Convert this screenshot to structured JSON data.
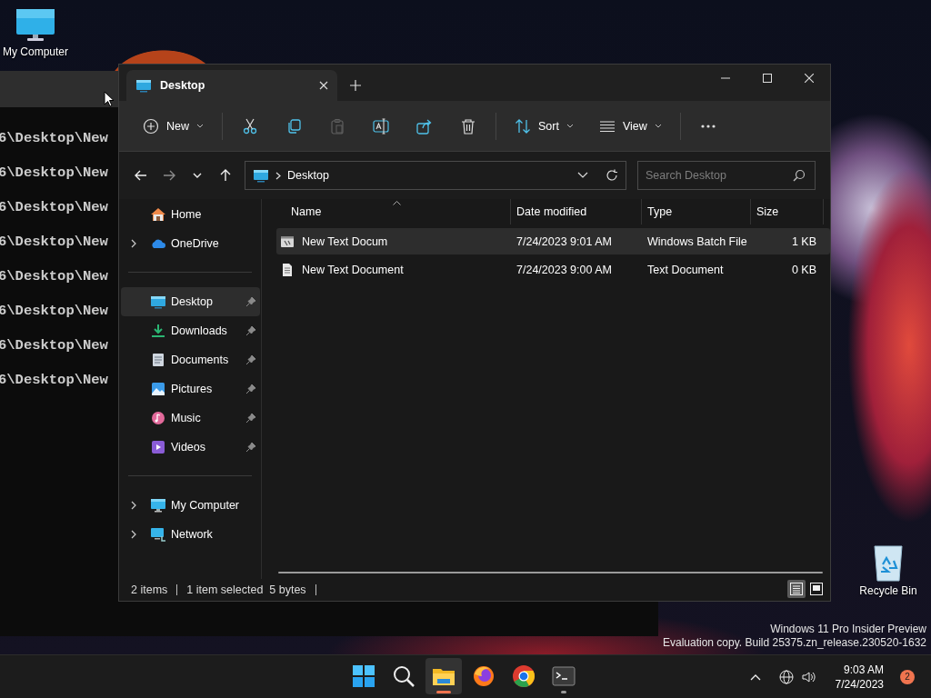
{
  "desktop_icons": [
    {
      "kind": "computer",
      "label": "My Computer"
    },
    {
      "kind": "recycle",
      "label": "Recycle Bin"
    }
  ],
  "terminal": {
    "lines": [
      "6\\Desktop\\New",
      "6\\Desktop\\New",
      "6\\Desktop\\New",
      "6\\Desktop\\New",
      "6\\Desktop\\New",
      "6\\Desktop\\New",
      "6\\Desktop\\New",
      "6\\Desktop\\New"
    ]
  },
  "explorer": {
    "tabs": [
      {
        "title": "Desktop",
        "selected": true
      }
    ],
    "toolbar": [
      {
        "kind": "new",
        "label": "New",
        "disabled": false
      },
      {
        "kind": "cut",
        "disabled": false
      },
      {
        "kind": "copy",
        "disabled": false
      },
      {
        "kind": "paste",
        "disabled": true
      },
      {
        "kind": "rename",
        "disabled": false
      },
      {
        "kind": "share",
        "disabled": false
      },
      {
        "kind": "delete",
        "disabled": false
      },
      {
        "kind": "sort",
        "label": "Sort",
        "disabled": false
      },
      {
        "kind": "view",
        "label": "View",
        "disabled": false
      },
      {
        "kind": "more",
        "disabled": false
      }
    ],
    "nav": [
      {
        "kind": "back",
        "disabled": false
      },
      {
        "kind": "forward",
        "disabled": true
      },
      {
        "kind": "recent",
        "disabled": false
      },
      {
        "kind": "up",
        "disabled": false
      }
    ],
    "address": "Desktop",
    "search": {
      "placeholder": "Search Desktop"
    },
    "sidebar": {
      "sections": [
        {
          "items": [
            {
              "kind": "home",
              "label": "Home",
              "expandable": false,
              "pinned": false,
              "selected": false
            },
            {
              "kind": "cloud",
              "label": "OneDrive",
              "expandable": true,
              "pinned": false,
              "selected": false
            }
          ]
        },
        {
          "items": [
            {
              "kind": "desktop",
              "label": "Desktop",
              "expandable": false,
              "pinned": true,
              "selected": true
            },
            {
              "kind": "downloads",
              "label": "Downloads",
              "expandable": false,
              "pinned": true,
              "selected": false
            },
            {
              "kind": "documents",
              "label": "Documents",
              "expandable": false,
              "pinned": true,
              "selected": false
            },
            {
              "kind": "pictures",
              "label": "Pictures",
              "expandable": false,
              "pinned": true,
              "selected": false
            },
            {
              "kind": "music",
              "label": "Music",
              "expandable": false,
              "pinned": true,
              "selected": false
            },
            {
              "kind": "videos",
              "label": "Videos",
              "expandable": false,
              "pinned": true,
              "selected": false
            }
          ]
        },
        {
          "items": [
            {
              "kind": "computer",
              "label": "My Computer",
              "expandable": true,
              "pinned": false,
              "selected": false
            },
            {
              "kind": "network",
              "label": "Network",
              "expandable": true,
              "pinned": false,
              "selected": false
            }
          ]
        }
      ]
    },
    "columns": [
      "Name",
      "Date modified",
      "Type",
      "Size"
    ],
    "rows": [
      {
        "kind": "batch",
        "name": "New Text Docum",
        "date": "7/24/2023 9:01 AM",
        "type": "Windows Batch File",
        "size": "1 KB",
        "selected": true
      },
      {
        "kind": "text",
        "name": "New Text Document",
        "date": "7/24/2023 9:00 AM",
        "type": "Text Document",
        "size": "0 KB",
        "selected": false
      }
    ],
    "status_bar": {
      "count": "2 items",
      "selection": "1 item selected  5 bytes"
    },
    "view_modes": [
      {
        "kind": "details",
        "selected": true
      },
      {
        "kind": "tiles",
        "selected": false
      }
    ]
  },
  "watermark": [
    "Windows 11 Pro Insider Preview",
    "Evaluation copy. Build 25375.zn_release.230520-1632"
  ],
  "taskbar": {
    "apps": [
      {
        "kind": "start",
        "active": false,
        "running": false
      },
      {
        "kind": "search",
        "active": false,
        "running": false
      },
      {
        "kind": "explorer",
        "active": true,
        "running": true
      },
      {
        "kind": "firefox",
        "active": false,
        "running": false
      },
      {
        "kind": "chrome",
        "active": false,
        "running": false
      },
      {
        "kind": "terminal",
        "active": false,
        "running": true
      }
    ],
    "time": "9:03 AM",
    "date": "7/24/2023",
    "notifications": "2"
  }
}
